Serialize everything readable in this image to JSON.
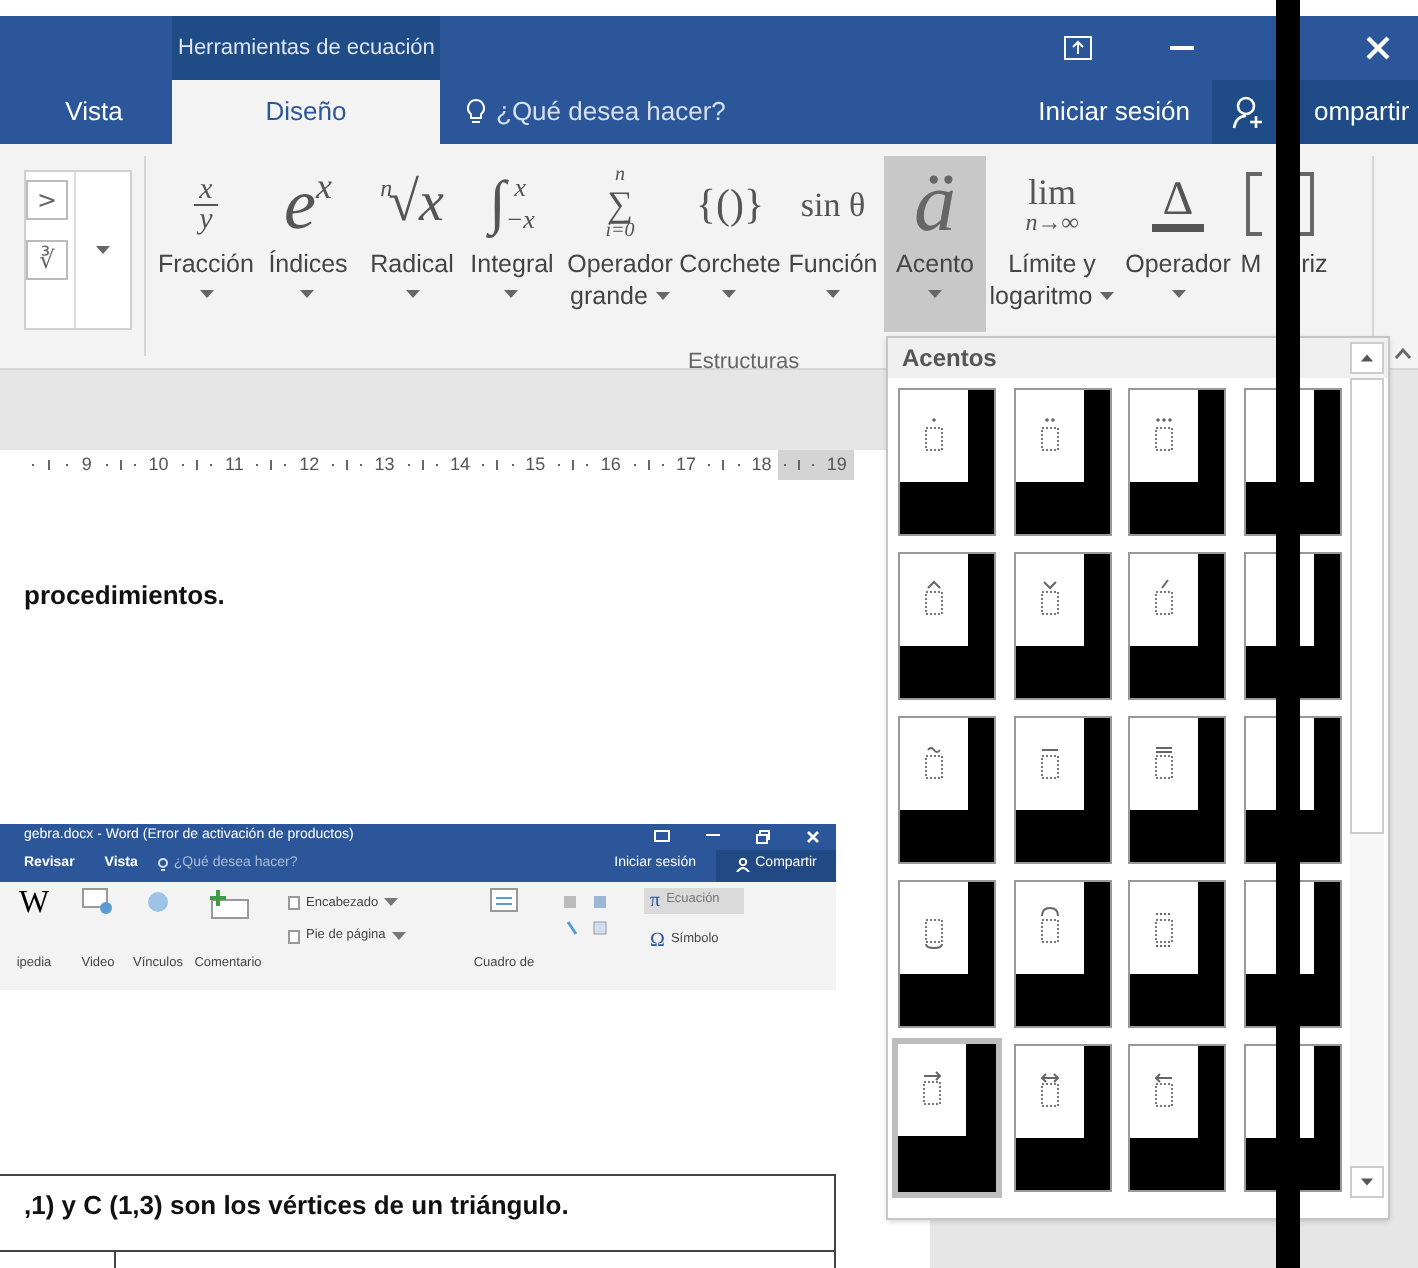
{
  "title_bar": {
    "context_tab": "Herramientas de ecuación"
  },
  "tabs": [
    {
      "label": "Vista",
      "selected": false
    },
    {
      "label": "Diseño",
      "selected": true
    }
  ],
  "tell_me": {
    "placeholder": "¿Qué desea hacer?"
  },
  "account": {
    "sign_in": "Iniciar sesión",
    "share": "ompartir"
  },
  "ribbon": {
    "symbol_gallery": [
      ">",
      "∛"
    ],
    "structures": [
      {
        "kind": "fraction",
        "glyphs": [
          "x",
          "y"
        ],
        "label_lines": [
          "Fracción"
        ],
        "dropdown": true,
        "selected": false
      },
      {
        "kind": "script",
        "glyphs": [
          "e",
          "x"
        ],
        "label_lines": [
          "Índices"
        ],
        "dropdown": true,
        "selected": false
      },
      {
        "kind": "radical",
        "glyphs": [
          "n",
          "√",
          "x"
        ],
        "label_lines": [
          "Radical"
        ],
        "dropdown": true,
        "selected": false
      },
      {
        "kind": "integral",
        "glyphs": [
          "∫",
          "x",
          "−x"
        ],
        "label_lines": [
          "Integral"
        ],
        "dropdown": true,
        "selected": false
      },
      {
        "kind": "large_operator",
        "glyphs": [
          "n",
          "∑",
          "i=0"
        ],
        "label_lines": [
          "Operador",
          "grande"
        ],
        "dropdown": true,
        "selected": false
      },
      {
        "kind": "bracket",
        "glyphs": [
          "{()}"
        ],
        "label_lines": [
          "Corchete"
        ],
        "dropdown": true,
        "selected": false
      },
      {
        "kind": "function",
        "glyphs": [
          "sin θ"
        ],
        "label_lines": [
          "Función"
        ],
        "dropdown": true,
        "selected": false
      },
      {
        "kind": "accent",
        "glyphs": [
          "ä"
        ],
        "label_lines": [
          "Acento"
        ],
        "dropdown": true,
        "selected": true
      },
      {
        "kind": "limit",
        "glyphs": [
          "lim",
          "n→∞"
        ],
        "label_lines": [
          "Límite y",
          "logaritmo"
        ],
        "dropdown": true,
        "selected": false
      },
      {
        "kind": "operator",
        "glyphs": [
          "Δ"
        ],
        "label_lines": [
          "Operador"
        ],
        "dropdown": true,
        "selected": false
      },
      {
        "kind": "matrix",
        "label_parts": [
          "M",
          "riz"
        ],
        "dropdown": false,
        "selected": false
      }
    ],
    "group_label": "Estructuras"
  },
  "ruler": {
    "numbers": [
      "9",
      "10",
      "11",
      "12",
      "13",
      "14",
      "15",
      "16",
      "17",
      "18",
      "19"
    ]
  },
  "document": {
    "heading": "procedimientos.",
    "embedded_window": {
      "title": "gebra.docx - Word (Error de activación de productos)",
      "tabs": [
        "Revisar",
        "Vista"
      ],
      "tell_me": "¿Qué desea hacer?",
      "sign_in": "Iniciar sesión",
      "share": "Compartir",
      "buttons": [
        {
          "kind": "wiki",
          "glyph": "W",
          "label": "ipedia"
        },
        {
          "kind": "video",
          "label": "Video"
        },
        {
          "kind": "links",
          "label": "Vínculos"
        },
        {
          "kind": "comment",
          "label": "Comentario"
        }
      ],
      "header_footer": [
        "Encabezado",
        "Pie de página"
      ],
      "text_box": "Cuadro de",
      "equation": {
        "glyph": "π",
        "label": "Ecuación"
      },
      "symbol": {
        "glyph": "Ω",
        "label": "Símbolo"
      }
    },
    "table": {
      "heading_cell": ",1) y C (1,3) son los vértices de un triángulo."
    }
  },
  "gallery": {
    "title": "Acentos",
    "tiles": [
      {
        "kind": "dot",
        "selected": false
      },
      {
        "kind": "ddot",
        "selected": false
      },
      {
        "kind": "dddot",
        "selected": false
      },
      {
        "selected": false
      },
      {
        "kind": "hat",
        "selected": false
      },
      {
        "kind": "check",
        "selected": false
      },
      {
        "kind": "acute",
        "selected": false
      },
      {
        "selected": false
      },
      {
        "kind": "tilde",
        "selected": false
      },
      {
        "kind": "bar",
        "selected": false
      },
      {
        "kind": "doublebar",
        "selected": false
      },
      {
        "selected": false
      },
      {
        "kind": "underbrace",
        "selected": false
      },
      {
        "kind": "overbrace",
        "selected": false
      },
      {
        "kind": "overunder",
        "selected": false
      },
      {
        "selected": false
      },
      {
        "kind": "arrow_right",
        "selected": true
      },
      {
        "kind": "arrow_both",
        "selected": false
      },
      {
        "kind": "arrow_left",
        "selected": false
      },
      {
        "selected": false
      }
    ]
  }
}
